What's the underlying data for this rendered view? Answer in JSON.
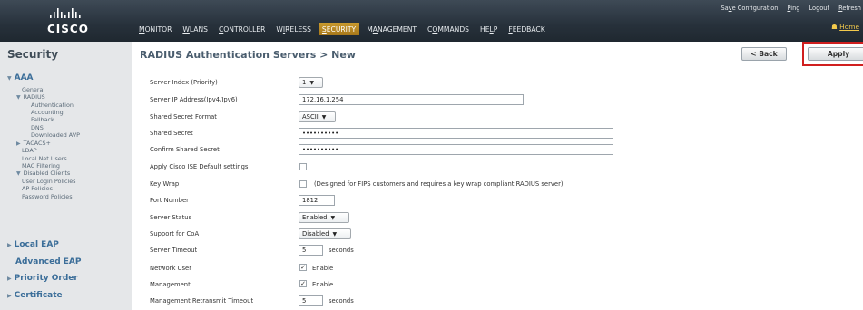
{
  "header": {
    "logo_text": "CISCO",
    "nav": [
      "MONITOR",
      "WLANs",
      "CONTROLLER",
      "WIRELESS",
      "SECURITY",
      "MANAGEMENT",
      "COMMANDS",
      "HELP",
      "FEEDBACK"
    ],
    "active_nav": "SECURITY",
    "top_links": [
      "Save Configuration",
      "Ping",
      "Logout",
      "Refresh"
    ],
    "home": "Home"
  },
  "sidebar": {
    "title": "Security",
    "items": {
      "aaa": "AAA",
      "general": "General",
      "radius": "RADIUS",
      "authentication": "Authentication",
      "accounting": "Accounting",
      "fallback": "Fallback",
      "dns": "DNS",
      "downloaded_avp": "Downloaded AVP",
      "tacacs": "TACACS+",
      "ldap": "LDAP",
      "local_net_users": "Local Net Users",
      "mac_filtering": "MAC Filtering",
      "disabled_clients": "Disabled Clients",
      "user_login_policies": "User Login Policies",
      "ap_policies": "AP Policies",
      "password_policies": "Password Policies",
      "local_eap": "Local EAP",
      "advanced_eap": "Advanced EAP",
      "priority_order": "Priority Order",
      "certificate": "Certificate"
    }
  },
  "page": {
    "title": "RADIUS Authentication Servers > New",
    "back": "< Back",
    "apply": "Apply"
  },
  "form": {
    "server_index_label": "Server Index (Priority)",
    "server_index_value": "1",
    "server_ip_label": "Server IP Address(Ipv4/Ipv6)",
    "server_ip_value": "172.16.1.254",
    "secret_format_label": "Shared Secret Format",
    "secret_format_value": "ASCII",
    "shared_secret_label": "Shared Secret",
    "shared_secret_value": "••••••••••",
    "confirm_secret_label": "Confirm Shared Secret",
    "confirm_secret_value": "••••••••••",
    "ise_default_label": "Apply Cisco ISE Default settings",
    "key_wrap_label": "Key Wrap",
    "key_wrap_note": "(Designed for FIPS customers and requires a key wrap compliant RADIUS server)",
    "port_label": "Port Number",
    "port_value": "1812",
    "status_label": "Server Status",
    "status_value": "Enabled",
    "coa_label": "Support for CoA",
    "coa_value": "Disabled",
    "timeout_label": "Server Timeout",
    "timeout_value": "5",
    "timeout_unit": "seconds",
    "network_user_label": "Network User",
    "network_user_enable": "Enable",
    "management_label": "Management",
    "management_enable": "Enable",
    "mgmt_retransmit_label": "Management Retransmit Timeout",
    "mgmt_retransmit_value": "5",
    "mgmt_retransmit_unit": "seconds"
  },
  "colors": {
    "header_bg": "#27313b",
    "active_tab": "#b8860b",
    "sidebar_bg": "#e5e7e9",
    "link_blue": "#3b6e99",
    "highlight_red": "#d01f1f"
  }
}
